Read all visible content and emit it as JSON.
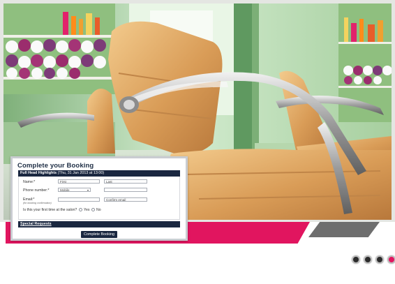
{
  "booking": {
    "title": "Complete your Booking",
    "service_label": "Full Head Highlights",
    "service_date": "(Thu, 31 Jan 2013 at 13:00)",
    "name_label": "Name:*",
    "first_placeholder": "First",
    "last_placeholder": "Last",
    "phone_label": "Phone number:*",
    "phone_type": "Mobile",
    "email_label": "Email:*",
    "email_note": "(for booking confirmation)",
    "confirm_email_placeholder": "Confirm email",
    "first_time_question": "Is this your first time at the salon?",
    "yes_label": "Yes",
    "no_label": "No",
    "special_requests": "Special Requests",
    "submit_label": "Complete Booking"
  },
  "carousel": {
    "dots": [
      {
        "label": "slide-1"
      },
      {
        "label": "slide-2"
      },
      {
        "label": "slide-3"
      },
      {
        "label": "slide-4",
        "active": true
      }
    ]
  },
  "colors": {
    "accent_pink": "#e1155f",
    "navy": "#1a2740",
    "grey_strip": "#6e6e6e"
  }
}
